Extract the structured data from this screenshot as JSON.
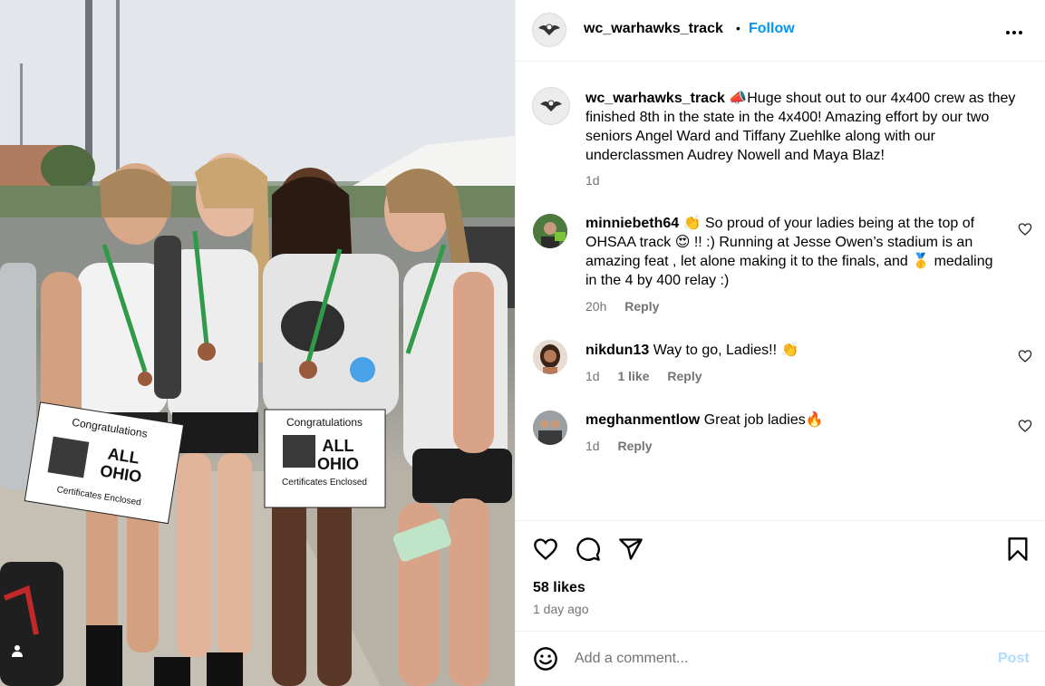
{
  "post": {
    "username": "wc_warhawks_track",
    "separator": "•",
    "follow_label": "Follow",
    "more_label": "•••",
    "image_alt": "Photo of four track athletes holding All Ohio certificates",
    "sign_left": {
      "line1": "Congratulations",
      "line2": "ALL",
      "line3": "OHIO",
      "line4": "Certificates Enclosed"
    },
    "sign_right": {
      "line1": "Congratulations",
      "line2": "ALL",
      "line3": "OHIO",
      "line4": "Certificates Enclosed"
    }
  },
  "caption": {
    "username": "wc_warhawks_track",
    "text": "📣Huge shout out to our 4x400 crew as they finished 8th in the state in the 4x400! Amazing effort by our two seniors Angel Ward and Tiffany Zuehlke along with our underclassmen Audrey Nowell and Maya Blaz!",
    "time": "1d"
  },
  "comments": [
    {
      "username": "minniebeth64",
      "text": "👏 So proud of your ladies being at the top of OHSAA track 😍 !! :) Running at Jesse Owen’s stadium is an amazing feat , let alone making it to the finals, and 🥇 medaling in the 4 by 400 relay :)",
      "time": "20h",
      "likes": "",
      "reply": "Reply"
    },
    {
      "username": "nikdun13",
      "text": "Way to go, Ladies!! 👏",
      "time": "1d",
      "likes": "1 like",
      "reply": "Reply"
    },
    {
      "username": "meghanmentlow",
      "text": "Great job ladies🔥",
      "time": "1d",
      "likes": "",
      "reply": "Reply"
    }
  ],
  "stats": {
    "likes": "58 likes",
    "date": "1 day ago"
  },
  "add_comment": {
    "placeholder": "Add a comment...",
    "post_label": "Post"
  },
  "colors": {
    "link_blue": "#0095f6",
    "muted": "#737373",
    "post_disabled": "#b3dbff",
    "divider": "#efefef"
  },
  "icons": [
    "heart-icon",
    "comment-icon",
    "share-icon",
    "bookmark-icon",
    "emoji-icon",
    "more-icon",
    "user-tag-icon"
  ]
}
